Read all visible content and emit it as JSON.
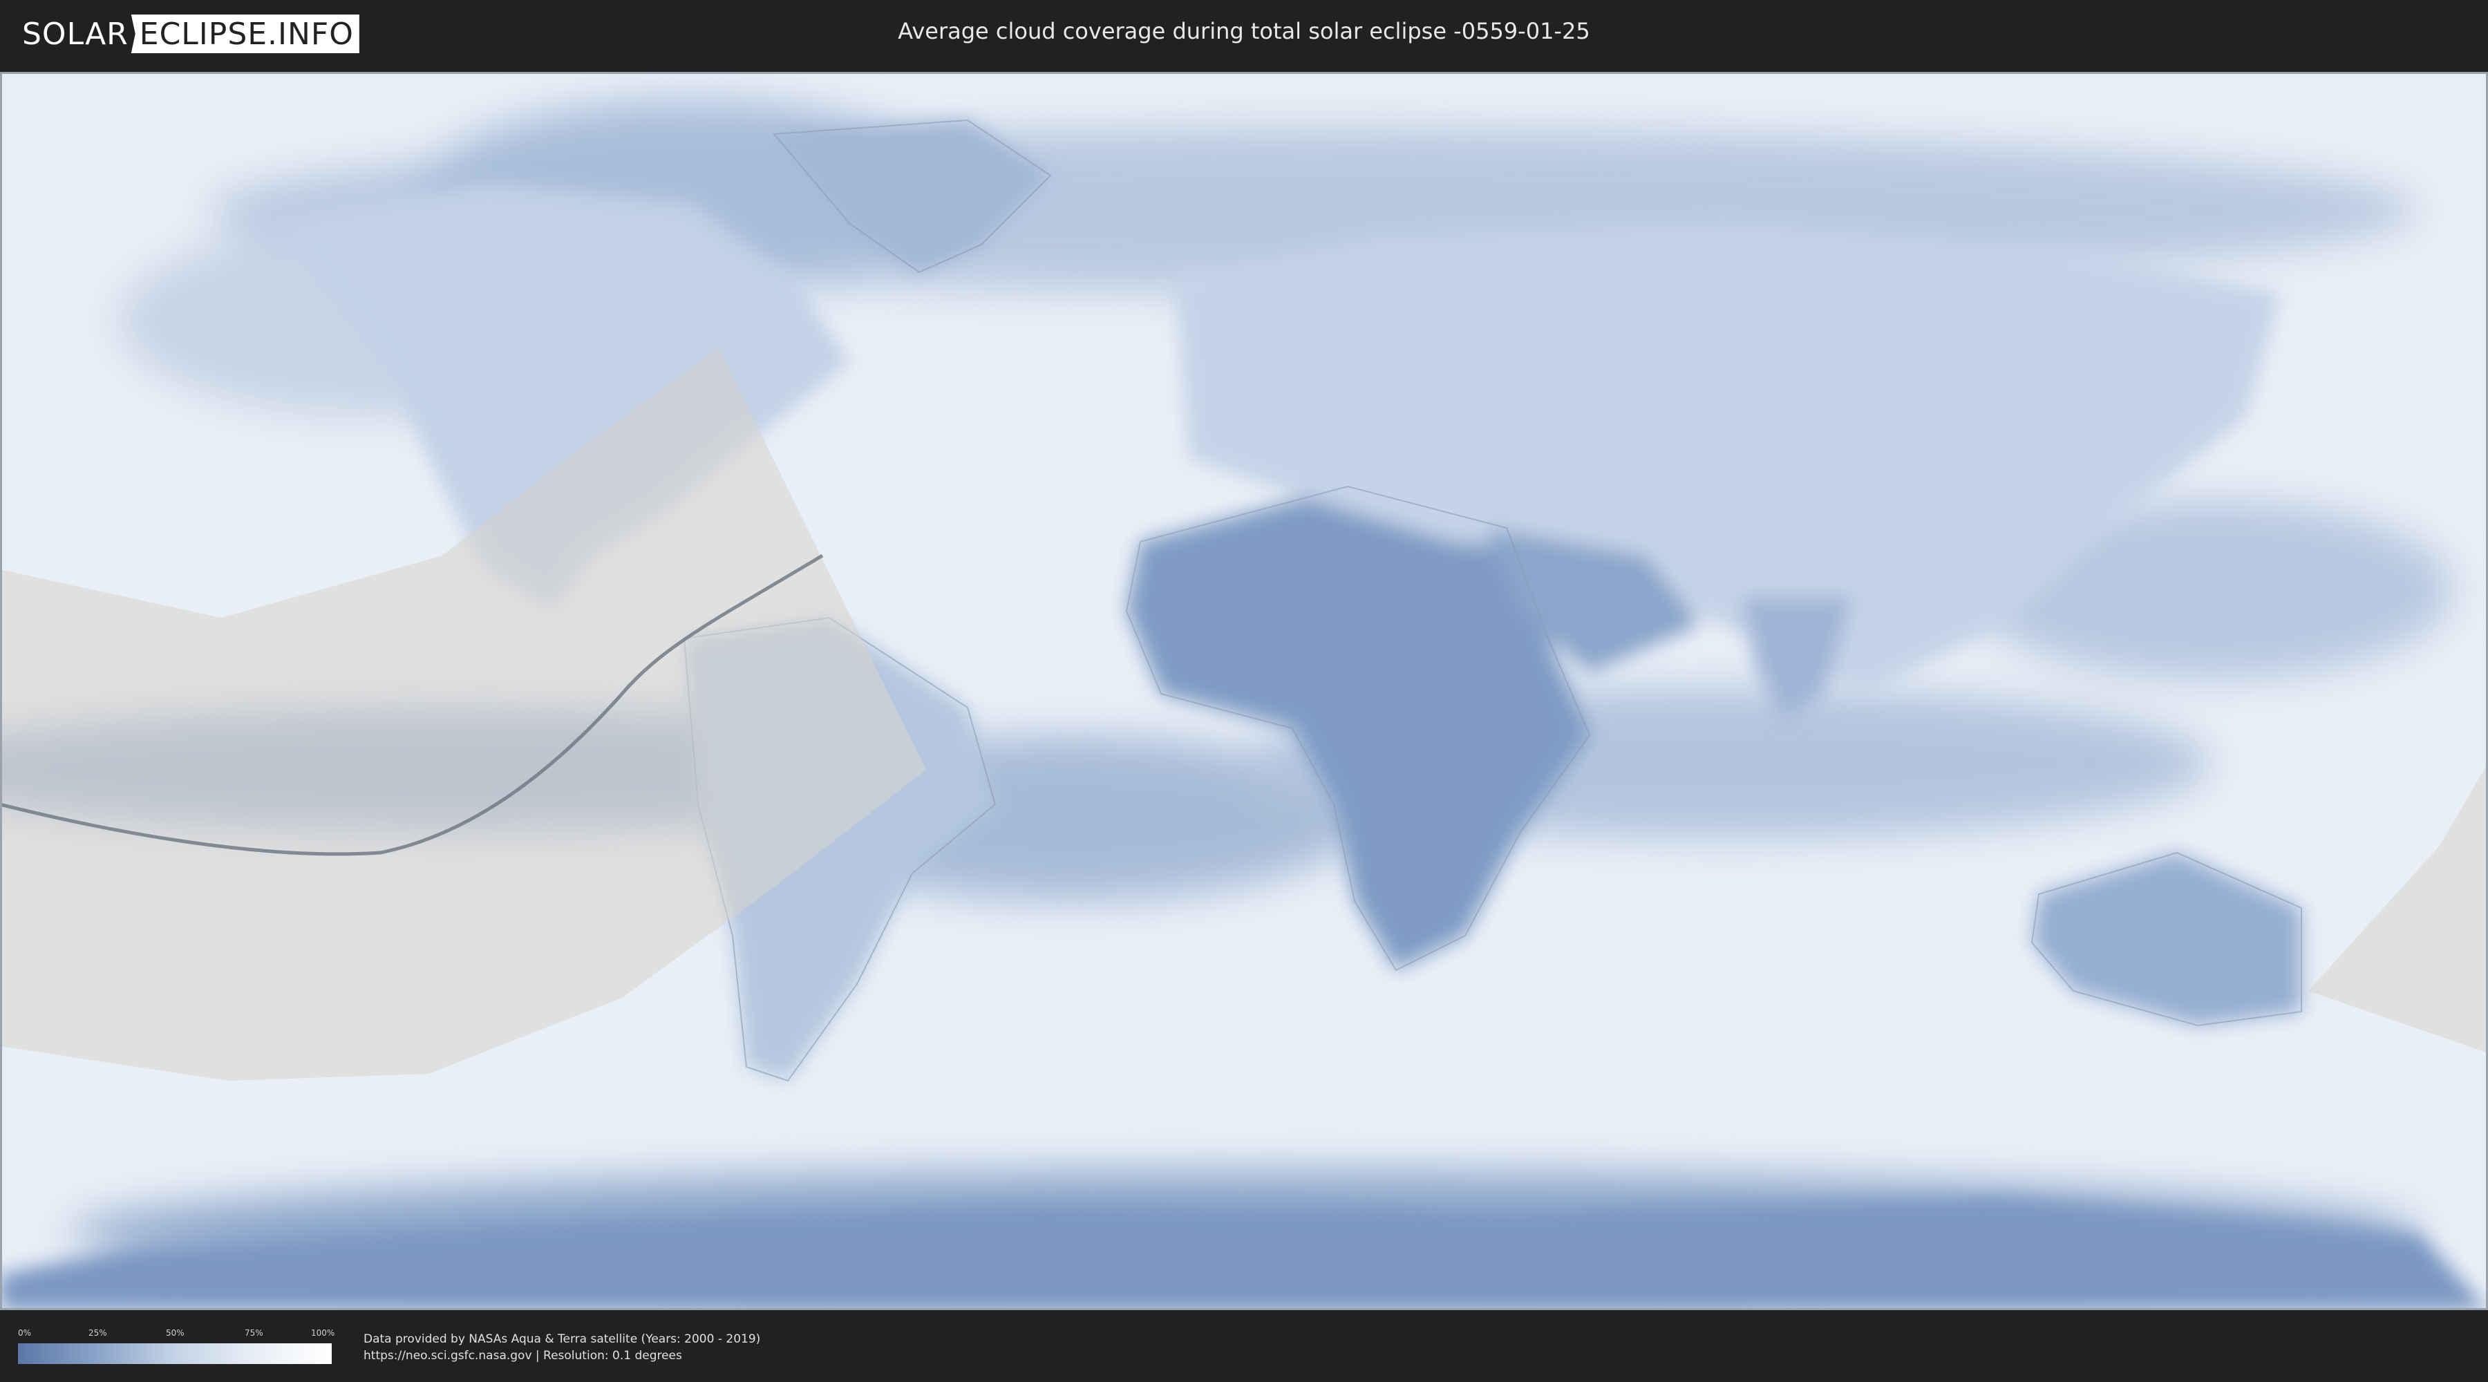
{
  "header": {
    "logo_part1": "SOLAR",
    "logo_part2": "ECLIPSE.INFO",
    "title": "Average cloud coverage during total solar eclipse -0559-01-25"
  },
  "legend": {
    "scale_labels": [
      "0%",
      "25%",
      "50%",
      "75%",
      "100%"
    ],
    "colors": [
      "#5a77a8",
      "#8aa3c8",
      "#c4d3e6",
      "#e8eef6",
      "#ffffff"
    ]
  },
  "credits": {
    "line1": "Data provided by NASAs Aqua & Terra satellite (Years: 2000 - 2019)",
    "line2": "https://neo.sci.gsfc.nasa.gov | Resolution: 0.1 degrees"
  },
  "map": {
    "background_color": "#e9eff7",
    "cloud_dark": "#6f8cb8",
    "eclipse_path_color": "#6a7580",
    "visibility_zone_color": "#d8d4cc"
  }
}
